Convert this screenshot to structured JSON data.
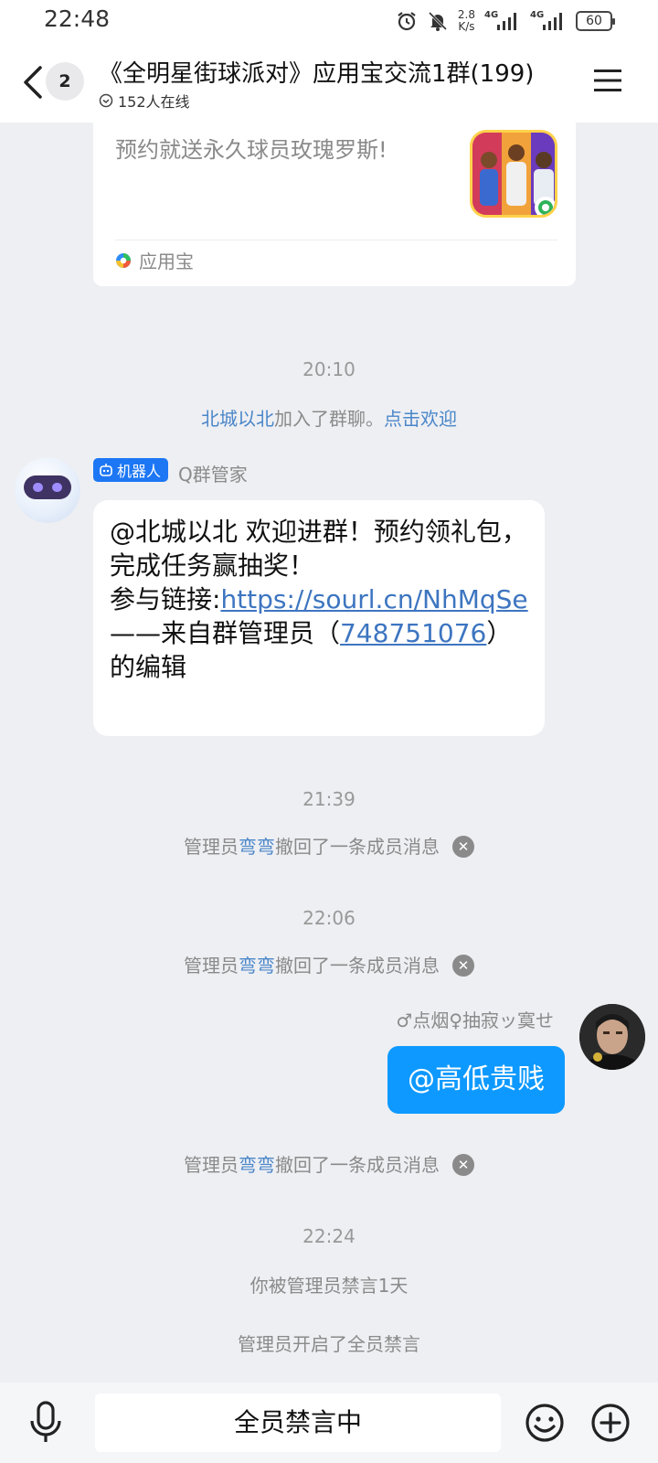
{
  "status_bar": {
    "time": "22:48",
    "speed_value": "2.8",
    "speed_unit": "K/s",
    "network1": "4G",
    "network2": "4G",
    "battery": "60"
  },
  "header": {
    "unread_count": "2",
    "title": "《全明星街球派对》应用宝交流1群(199)",
    "online": "152人在线"
  },
  "card": {
    "text": "预约就送永久球员玫瑰罗斯!",
    "source": "应用宝"
  },
  "messages": {
    "time1": "20:10",
    "join_name": "北城以北",
    "join_text": "加入了群聊。",
    "join_action": "点击欢迎",
    "bot_tag": "机器人",
    "bot_name": "Q群管家",
    "bot_line1": "@北城以北 欢迎进群！预约领礼包，完成任务赢抽奖！",
    "bot_link_prefix": "参与链接:",
    "bot_link": "https://sourl.cn/NhMqSe",
    "bot_footer_prefix": "——来自群管理员（",
    "bot_footer_id": "748751076",
    "bot_footer_suffix": "）的编辑",
    "time2": "21:39",
    "recall_prefix": "管理员",
    "recall_admin": "弯弯",
    "recall_text": "撤回了一条成员消息",
    "time3": "22:06",
    "me_name": "♂点烟♀抽寂ッ寞せ",
    "me_text": "@高低贵贱",
    "time4": "22:24",
    "muted_you": "你被管理员禁言1天",
    "muted_all": "管理员开启了全员禁言"
  },
  "bottom": {
    "input_text": "全员禁言中"
  }
}
